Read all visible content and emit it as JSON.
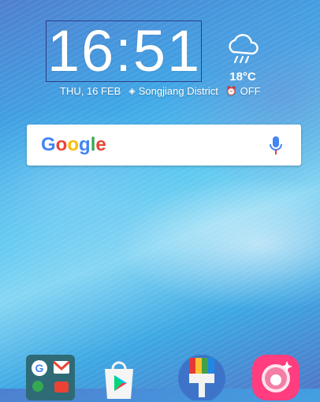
{
  "clock": {
    "time": "16:51"
  },
  "status_line": {
    "date": "THU, 16 FEB",
    "location": "Songjiang District",
    "alarm": "OFF"
  },
  "weather": {
    "temperature": "18°C",
    "icon": "cloud-rain-icon"
  },
  "search": {
    "logo_text": "Google",
    "mic_icon": "mic-icon"
  },
  "colors": {
    "google_blue": "#4285F4",
    "google_red": "#EA4335",
    "google_yellow": "#FBBC05",
    "google_green": "#34A853"
  },
  "dock": {
    "apps": [
      {
        "icon": "google-folder-icon"
      },
      {
        "icon": "play-store-icon"
      },
      {
        "icon": "themes-icon"
      },
      {
        "icon": "selfie-camera-icon"
      }
    ]
  }
}
